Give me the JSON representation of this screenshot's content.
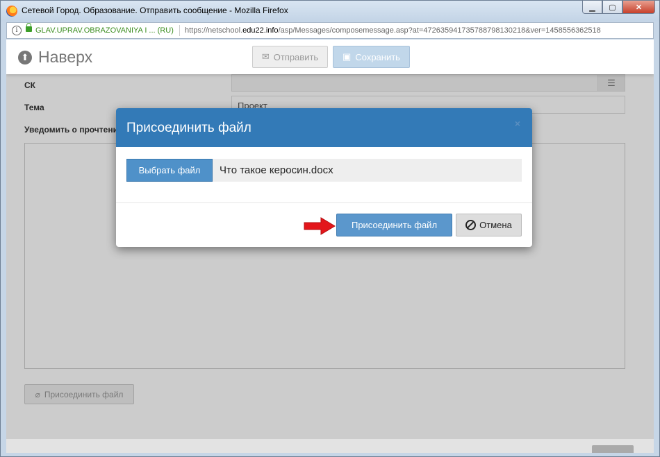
{
  "window": {
    "title": "Сетевой Город. Образование. Отправить сообщение - Mozilla Firefox",
    "controls": [
      "minimize",
      "maximize",
      "close"
    ]
  },
  "urlbar": {
    "organization": "GLAV.UPRAV.OBRAZOVANIYA I ... (RU)",
    "url_prefix": "https://netschool.",
    "url_domain": "edu22.info",
    "url_suffix": "/asp/Messages/composemessage.asp?at=472635941735788798130218&ver=1458556362518"
  },
  "toolbar": {
    "up_label": "Наверх",
    "send_label": "Отправить",
    "save_label": "Сохранить"
  },
  "form": {
    "cc_label": "СК",
    "subject_label": "Тема",
    "subject_value": "Проект",
    "notify_label": "Уведомить о прочтении",
    "attach_label": "Присоединить файл"
  },
  "modal": {
    "title": "Присоединить файл",
    "close_glyph": "×",
    "choose_label": "Выбрать файл",
    "file_name": "Что такое керосин.docx",
    "attach_label": "Присоединить файл",
    "cancel_label": "Отмена"
  },
  "colors": {
    "primary": "#337ab7",
    "arrow": "#e3161b"
  }
}
